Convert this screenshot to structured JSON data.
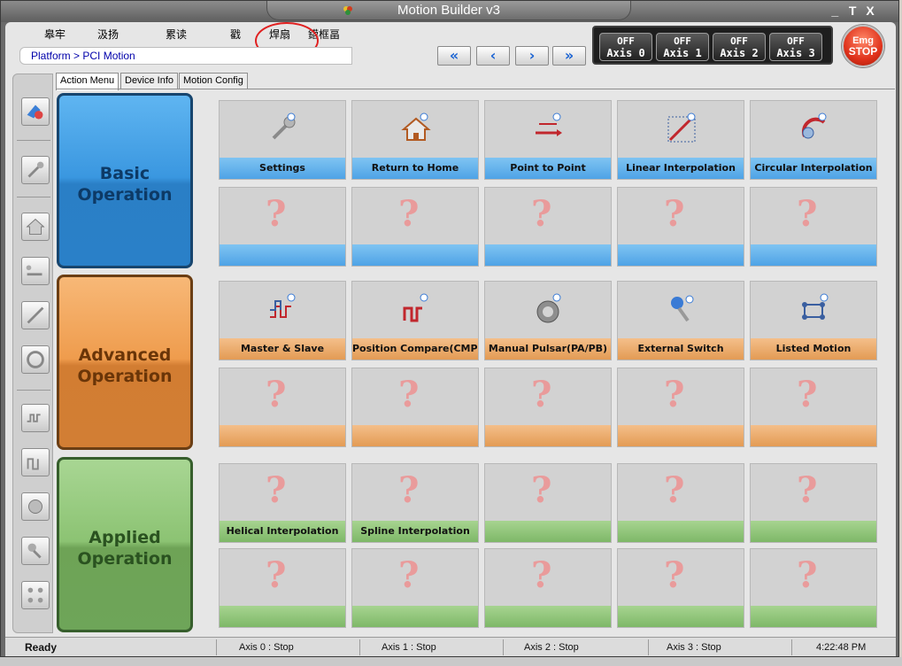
{
  "window": {
    "title": "Motion Builder v3",
    "controls": {
      "minimize": "_",
      "maximize": "T",
      "close": "X"
    }
  },
  "menu": {
    "items": [
      "皋牢",
      "汲扬",
      "累读",
      "戳",
      "焊扇",
      "鍣框畐"
    ]
  },
  "breadcrumb": "Platform > PCI Motion",
  "nav": {
    "first": "«",
    "prev": "‹",
    "next": "›",
    "last": "»"
  },
  "axes": [
    {
      "state": "OFF",
      "label": "Axis",
      "num": "0"
    },
    {
      "state": "OFF",
      "label": "Axis",
      "num": "1"
    },
    {
      "state": "OFF",
      "label": "Axis",
      "num": "2"
    },
    {
      "state": "OFF",
      "label": "Axis",
      "num": "3"
    }
  ],
  "emergency": {
    "line1": "Emg",
    "line2": "STOP"
  },
  "tabs": [
    "Action Menu",
    "Device Info",
    "Motion Config"
  ],
  "categories": {
    "basic": [
      "Basic",
      "Operation"
    ],
    "advanced": [
      "Advanced",
      "Operation"
    ],
    "applied": [
      "Applied",
      "Operation"
    ]
  },
  "tiles": {
    "basic": [
      "Settings",
      "Return to Home",
      "Point to Point",
      "Linear Interpolation",
      "Circular Interpolation"
    ],
    "advanced": [
      "Master & Slave",
      "Position Compare(CMP)",
      "Manual Pulsar(PA/PB)",
      "External Switch",
      "Listed Motion"
    ],
    "applied": [
      "Helical Interpolation",
      "Spline Interpolation"
    ]
  },
  "status": {
    "ready": "Ready",
    "axis0": "Axis 0 :   Stop",
    "axis1": "Axis 1 :   Stop",
    "axis2": "Axis 2 :   Stop",
    "axis3": "Axis 3 :   Stop",
    "time": "4:22:48 PM"
  },
  "colors": {
    "basic": "#3a97e0",
    "advanced": "#ef9c4d",
    "applied": "#8cc373",
    "emergency": "#e0321b",
    "annotation": "#e02020"
  }
}
